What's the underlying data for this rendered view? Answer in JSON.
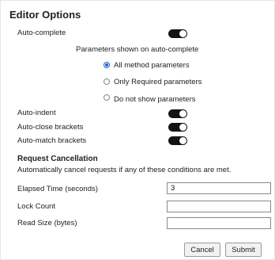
{
  "dialog": {
    "title": "Editor Options"
  },
  "auto_complete": {
    "label": "Auto-complete",
    "enabled": true,
    "subheading": "Parameters shown on auto-complete",
    "options": [
      {
        "label": "All method parameters",
        "selected": true
      },
      {
        "label": "Only Required parameters",
        "selected": false
      },
      {
        "label": "Do not show parameters",
        "selected": false
      }
    ]
  },
  "toggles": [
    {
      "label": "Auto-indent",
      "enabled": true
    },
    {
      "label": "Auto-close brackets",
      "enabled": true
    },
    {
      "label": "Auto-match brackets",
      "enabled": true
    }
  ],
  "request_cancellation": {
    "heading": "Request Cancellation",
    "description": "Automatically cancel requests if any of these conditions are met.",
    "fields": [
      {
        "label": "Elapsed Time (seconds)",
        "value": "3"
      },
      {
        "label": "Lock Count",
        "value": ""
      },
      {
        "label": "Read Size (bytes)",
        "value": ""
      }
    ]
  },
  "buttons": {
    "cancel": "Cancel",
    "submit": "Submit"
  },
  "colors": {
    "toggle_on": "#141414",
    "radio_selected": "#1a5fd0"
  }
}
